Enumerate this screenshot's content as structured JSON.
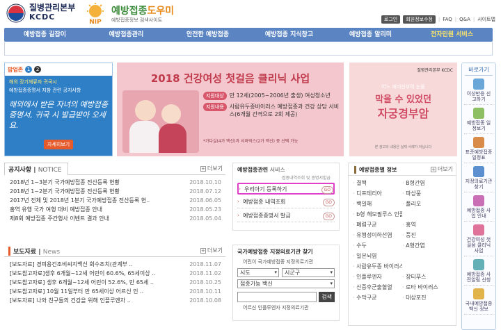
{
  "header": {
    "org_name": "질병관리본부",
    "org_abbr": "KCDC",
    "nip_mark": "NIP",
    "site_title_a": "예방접종",
    "site_title_b": "도우미",
    "site_sub": "예방접종정보 검색사이트",
    "util": {
      "login": "로그인",
      "signup": "회원정보수정",
      "faq": "FAQ",
      "qa": "Q&A",
      "sitemap": "사이트맵"
    }
  },
  "nav": [
    "예방접종 길잡이",
    "예방접종관리",
    "안전한 예방접종",
    "예방접종 지식창고",
    "예방접종 알리미",
    "전자민원 서비스"
  ],
  "popup": {
    "label": "팝업존",
    "nums": [
      "1",
      "2"
    ],
    "line1": "해외 장기체류자 귀국시",
    "line2": "예방접종증명서 지참 관련 공지사항",
    "hand": "해외에서 받은 자녀의 예방접종증명서, 귀국 시 발급받아 오세요.",
    "btn": "자세히보기"
  },
  "main_banner": {
    "title": "2018 건강여성 첫걸음 클리닉 사업",
    "rows": [
      {
        "tag": "지원대상",
        "text": "만 12세(2005~2006년 출생) 여성청소년"
      },
      {
        "tag": "지원내용",
        "text": "사람유두종바이러스 예방접종과 건강 상담 서비스(6개월 간격으로 2회 제공)"
      }
    ],
    "note": "*가다실(4가 백신)과 서바릭스(2가 백신) 중 선택 가능"
  },
  "right_banner": {
    "logo": "질병관리본부 KCDC",
    "small": "어느 예비신부의 눈물",
    "t1": "막을 수 있었던",
    "t2": "자궁경부암",
    "foot": "본 광고의 내용은 실제 사례가 아닙니다"
  },
  "quick": {
    "title": "바로가기",
    "items": [
      {
        "label": "이상반응 신고하기",
        "color": "#6aa6d8"
      },
      {
        "label": "예방접종 일정보기",
        "color": "#8fbf63"
      },
      {
        "label": "표준예방접종 일정표",
        "color": "#d98c4a"
      },
      {
        "label": "지정의료기관 찾기",
        "color": "#5b8fd0"
      },
      {
        "label": "예방접종 사업 안내",
        "color": "#c86fb5"
      },
      {
        "label": "건강여성 첫걸음 클리닉 사업",
        "color": "#e0739a"
      },
      {
        "label": "예방접종 사전알림 신청",
        "color": "#64b0b7"
      },
      {
        "label": "국내예방접종 백신 정보",
        "color": "#e0b44a"
      }
    ]
  },
  "notice": {
    "title": "공지사항",
    "title_en": "NOTICE",
    "more": "더보기",
    "items": [
      {
        "t": "2018년 1~3분기 국가예방접종 전산등록 현황",
        "d": "2018.10.10"
      },
      {
        "t": "2018년 1~2분기 국가예방접종 전산등록 현황",
        "d": "2018.07.12"
      },
      {
        "t": "2017년 전체 및 2018년 1분기 국가예방접종 전산등록 현..",
        "d": "2018.06.05"
      },
      {
        "t": "홍역 유행 국가 여행 대비 예방접종 안내",
        "d": "2018.05.23"
      },
      {
        "t": "제8회 예방접종 주간행사 이벤트 결과 안내",
        "d": "2018.05.04"
      }
    ]
  },
  "press": {
    "title": "보도자료",
    "title_en": "News",
    "more": "더보기",
    "items": [
      {
        "t": "[보도자료] 경피용건조비씨지백신 회수조치(관계부 ..",
        "d": "2018.11.07"
      },
      {
        "t": "[보도참고자료]생후 6개월~12세 어린이 60.6%, 65세이상 ..",
        "d": "2018.11.02"
      },
      {
        "t": "[보도참고자료] 생후 6개월~12세 어린이 52.6%, 만 65세 ..",
        "d": "2018.10.25"
      },
      {
        "t": "[보도참고자료] 10월 11일부터 만 65세이상 어르신 인 ..",
        "d": "2018.10.11"
      },
      {
        "t": "[보도자료] 나와 친구들의 건강을 위해 인플루엔자 ..",
        "d": "2018.10.08"
      }
    ]
  },
  "service": {
    "title": "예방접종관련",
    "title_b": "서비스",
    "sub": "접종내역조회 및 증명서발급",
    "go": "GO",
    "items": [
      "우리아기 등록하기",
      "예방접종 내역조회",
      "예방접종증명서 발급"
    ]
  },
  "hospital": {
    "title": "국가예방접종 지정의료기관 찾기",
    "link": "어린이 국가예방접종 지정의료기관",
    "sido": "시도",
    "sigungu": "시군구",
    "vaccine": "접종가능 백신",
    "search": "검색",
    "link2": "어르신 인플루엔자 지정의료기관"
  },
  "disease": {
    "title": "예방접종별 정보",
    "more": "더보기",
    "items": [
      "결핵",
      "B형간염",
      "디프테리아",
      "파상풍",
      "백일해",
      "폴리오",
      "b형 헤모필루스 인플루엔자",
      "",
      "폐렴구균",
      "홍역",
      "유행성이하선염",
      "풍진",
      "수두",
      "A형간염",
      "일본뇌염",
      "",
      "사람유두종 바이러스",
      "",
      "인플루엔자",
      "장티푸스",
      "신증후군출혈열",
      "로타 바이러스",
      "수막구균",
      "대상포진"
    ]
  }
}
